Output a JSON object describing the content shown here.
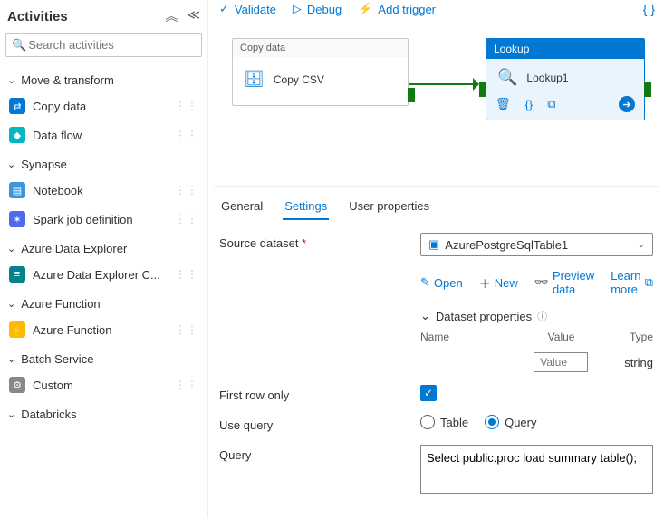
{
  "sidebar": {
    "title": "Activities",
    "search_placeholder": "Search activities",
    "groups": [
      {
        "label": "Move & transform",
        "expanded": true,
        "items": [
          {
            "label": "Copy data",
            "icon": "copy"
          },
          {
            "label": "Data flow",
            "icon": "df"
          }
        ]
      },
      {
        "label": "Synapse",
        "expanded": true,
        "items": [
          {
            "label": "Notebook",
            "icon": "nb"
          },
          {
            "label": "Spark job definition",
            "icon": "spark"
          }
        ]
      },
      {
        "label": "Azure Data Explorer",
        "expanded": true,
        "items": [
          {
            "label": "Azure Data Explorer C...",
            "icon": "adx"
          }
        ]
      },
      {
        "label": "Azure Function",
        "expanded": true,
        "items": [
          {
            "label": "Azure Function",
            "icon": "fn"
          }
        ]
      },
      {
        "label": "Batch Service",
        "expanded": true,
        "items": [
          {
            "label": "Custom",
            "icon": "cust"
          }
        ]
      },
      {
        "label": "Databricks",
        "expanded": true,
        "items": []
      }
    ]
  },
  "toolbar": {
    "validate": "Validate",
    "debug": "Debug",
    "add_trigger": "Add trigger"
  },
  "canvas": {
    "copy_node": {
      "type": "Copy data",
      "name": "Copy CSV"
    },
    "lookup_node": {
      "type": "Lookup",
      "name": "Lookup1"
    }
  },
  "tabs": {
    "general": "General",
    "settings": "Settings",
    "user_properties": "User properties",
    "active": "settings"
  },
  "settings": {
    "source_dataset_label": "Source dataset",
    "source_dataset_value": "AzurePostgreSqlTable1",
    "open": "Open",
    "new": "New",
    "preview": "Preview data",
    "learn_more": "Learn more",
    "dataset_properties_label": "Dataset properties",
    "columns": {
      "name": "Name",
      "value": "Value",
      "type": "Type"
    },
    "value_placeholder": "Value",
    "type_value": "string",
    "first_row_label": "First row only",
    "first_row_checked": true,
    "use_query_label": "Use query",
    "use_query_table": "Table",
    "use_query_query": "Query",
    "use_query_selected": "Query",
    "query_label": "Query",
    "query_value": "Select public.proc load summary table();",
    "query_highlight": "public.proc"
  }
}
